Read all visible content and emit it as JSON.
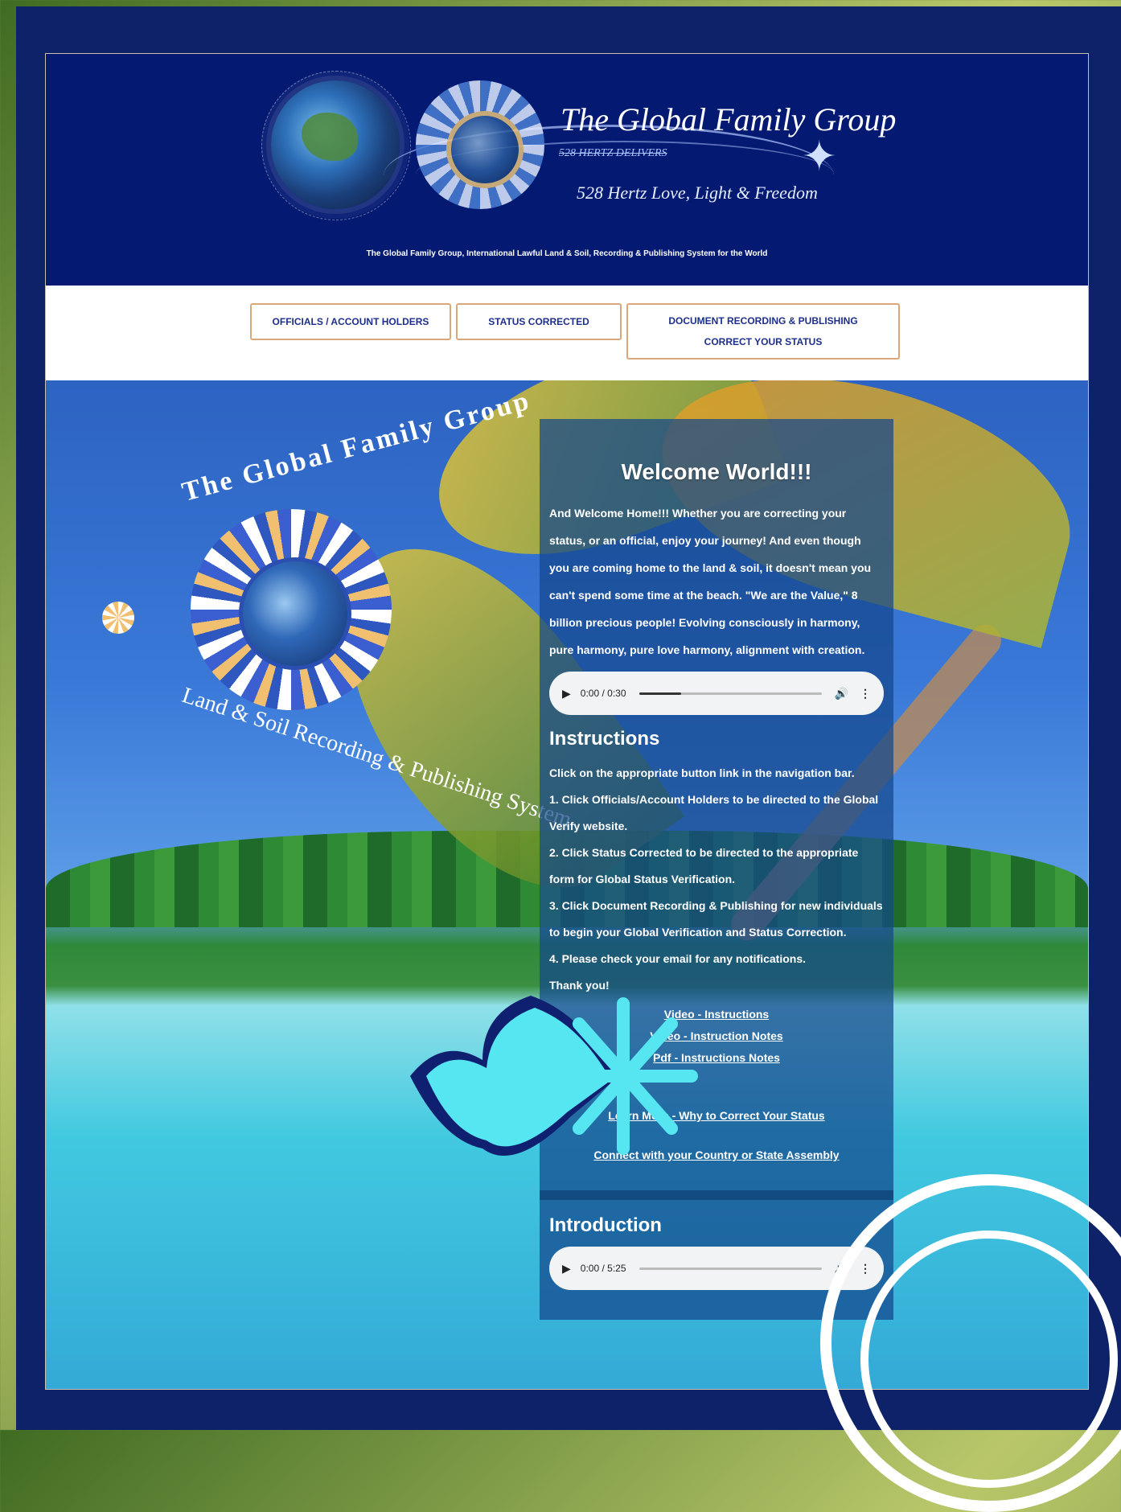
{
  "header": {
    "brand_title": "The Global Family Group",
    "brand_sub1": "528 HERTZ DELIVERS",
    "brand_sub2": "528 Hertz Love, Light & Freedom",
    "tagline": "The Global Family Group, International Lawful Land & Soil, Recording & Publishing System for the World"
  },
  "nav": {
    "items": [
      {
        "label": "OFFICIALS / ACCOUNT HOLDERS"
      },
      {
        "label": "STATUS CORRECTED"
      },
      {
        "label_line1": "DOCUMENT RECORDING & PUBLISHING",
        "label_line2": "CORRECT YOUR STATUS"
      }
    ]
  },
  "emblem": {
    "title": "The Global Family Group",
    "subtitle": "Land & Soil Recording & Publishing System"
  },
  "panel": {
    "welcome_title": "Welcome World!!!",
    "welcome_text": "And Welcome Home!!! Whether you are correcting your status, or an official, enjoy your journey! And even though you are coming home to the land & soil, it doesn't mean you can't spend some time at the beach. \"We are the Value,\" 8 billion precious people! Evolving consciously in harmony, pure harmony, pure love harmony, alignment with creation.",
    "audio1": {
      "time": "0:00 / 0:30",
      "progress": 0.23
    },
    "instructions_title": "Instructions",
    "instructions": [
      "Click on the appropriate button link in the navigation bar.",
      "1. Click Officials/Account Holders to be directed to the Global Verify website.",
      "2. Click Status Corrected to be directed to the appropriate form for Global Status Verification.",
      "3. Click Document Recording & Publishing for new individuals to begin your Global Verification and Status Correction.",
      "4. Please check your email for any notifications.",
      "Thank you!"
    ],
    "links": {
      "video_instructions": "Video - Instructions",
      "video_notes": "Video - Instruction Notes",
      "pdf_notes": "Pdf - Instructions Notes",
      "learn_more": "Learn More - Why to Correct Your Status",
      "connect": "Connect with your Country or State Assembly"
    },
    "introduction_title": "Introduction",
    "audio2": {
      "time": "0:00 / 5:25",
      "progress": 0.0
    }
  },
  "icons": {
    "play": "play-icon",
    "volume": "volume-icon",
    "more": "more-vert-icon"
  },
  "colors": {
    "frame": "#0d2268",
    "header": "#041a72",
    "nav_border": "#d9a87a",
    "nav_text": "#1d2f8a",
    "fish": "#56e6f2"
  }
}
